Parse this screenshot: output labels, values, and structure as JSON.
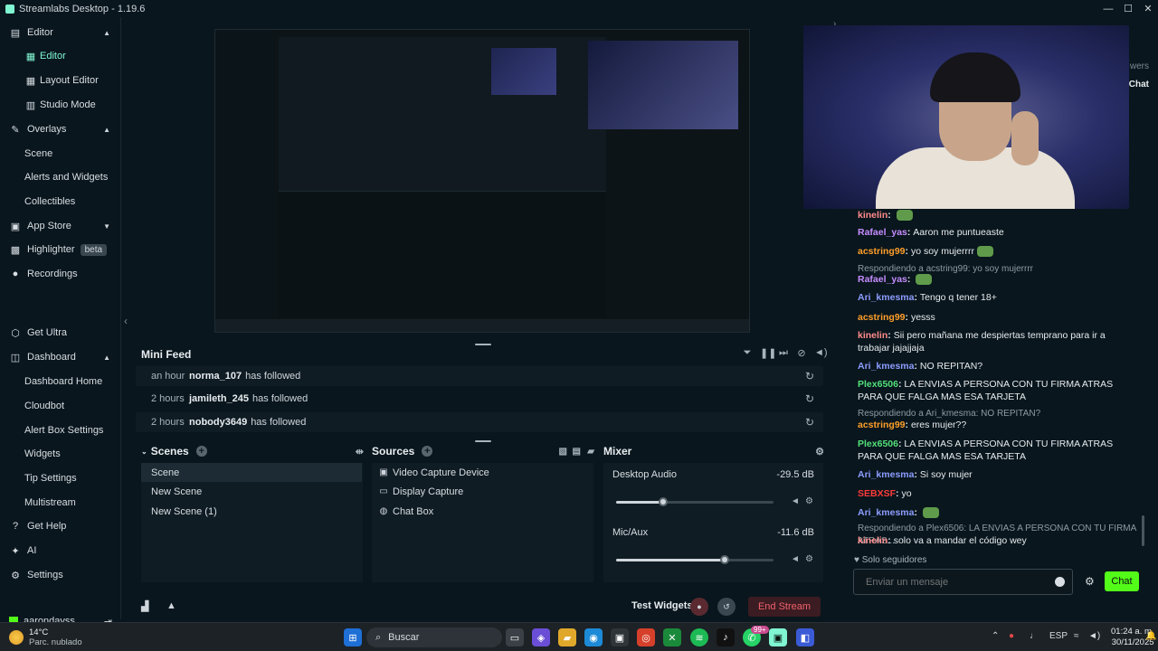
{
  "app": {
    "title": "Streamlabs Desktop - 1.19.6"
  },
  "sidebar": {
    "editor": "Editor",
    "editor_items": [
      "Editor",
      "Layout Editor",
      "Studio Mode"
    ],
    "overlays": "Overlays",
    "overlay_items": [
      "Scene",
      "Alerts and Widgets",
      "Collectibles"
    ],
    "app_store": "App Store",
    "highlighter": "Highlighter",
    "highlighter_badge": "beta",
    "recordings": "Recordings",
    "get_ultra": "Get Ultra",
    "dashboard": "Dashboard",
    "dashboard_items": [
      "Dashboard Home",
      "Cloudbot",
      "Alert Box Settings",
      "Widgets",
      "Tip Settings",
      "Multistream"
    ],
    "get_help": "Get Help",
    "ai": "AI",
    "settings": "Settings",
    "username": "aarondayss"
  },
  "minifeed": {
    "title": "Mini Feed",
    "rows": [
      {
        "time": "an hour",
        "user": "norma_107",
        "text": "has followed"
      },
      {
        "time": "2 hours",
        "user": "jamileth_245",
        "text": "has followed"
      },
      {
        "time": "2 hours",
        "user": "nobody3649",
        "text": "has followed"
      }
    ]
  },
  "scenes": {
    "title": "Scenes",
    "items": [
      "Scene",
      "New Scene",
      "New Scene (1)"
    ]
  },
  "sources": {
    "title": "Sources",
    "items": [
      "Video Capture Device",
      "Display Capture",
      "Chat Box"
    ]
  },
  "mixer": {
    "title": "Mixer",
    "channels": [
      {
        "name": "Desktop Audio",
        "db": "-29.5 dB",
        "level": 0.3
      },
      {
        "name": "Mic/Aux",
        "db": "-11.6 dB",
        "level": 0.69
      }
    ]
  },
  "bottom": {
    "test_widgets": "Test Widgets",
    "end_stream": "End Stream"
  },
  "chat": {
    "top_right_1": "wers",
    "top_right_2": "Chat",
    "messages": [
      {
        "name": "kinelin",
        "color": "#ff8c8c",
        "text": "",
        "emote": true
      },
      {
        "name": "Rafael_yas",
        "color": "#c68cff",
        "text": "Aaron me puntueaste"
      },
      {
        "name": "acstring99",
        "color": "#ff9f2a",
        "text": "yo soy mujerrrr",
        "emote": true
      },
      {
        "reply": "Respondiendo a acstring99: yo soy mujerrrr"
      },
      {
        "name": "Rafael_yas",
        "color": "#c68cff",
        "text": "",
        "emote": true
      },
      {
        "name": "Ari_kmesma",
        "color": "#8c9dff",
        "text": "Tengo q tener 18+"
      },
      {
        "name": "acstring99",
        "color": "#ff9f2a",
        "text": "yesss"
      },
      {
        "name": "kinelin",
        "color": "#ff8c8c",
        "text": "Sii pero mañana me despiertas temprano para ir a trabajar jajajjaja"
      },
      {
        "name": "Ari_kmesma",
        "color": "#8c9dff",
        "text": "NO REPITAN?"
      },
      {
        "name": "Plex6506",
        "color": "#53e07a",
        "text": "LA ENVIAS A PERSONA CON TU FIRMA ATRAS PARA QUE FALGA MAS ESA TARJETA"
      },
      {
        "reply": "Respondiendo a Ari_kmesma: NO REPITAN?"
      },
      {
        "name": "acstring99",
        "color": "#ff9f2a",
        "text": "eres mujer??"
      },
      {
        "name": "Plex6506",
        "color": "#53e07a",
        "text": "LA ENVIAS A PERSONA CON TU FIRMA ATRAS PARA QUE FALGA MAS ESA TARJETA"
      },
      {
        "name": "Ari_kmesma",
        "color": "#8c9dff",
        "text": "Si soy mujer"
      },
      {
        "name": "SEBXSF",
        "color": "#ff3b3b",
        "text": "yo"
      },
      {
        "name": "Ari_kmesma",
        "color": "#8c9dff",
        "text": "",
        "emote": true
      },
      {
        "reply": "Respondiendo a Plex6506: LA ENVIAS A PERSONA CON TU FIRMA ATRAS..."
      },
      {
        "name": "kinelin",
        "color": "#ff8c8c",
        "text": "solo va a mandar el código wey"
      }
    ],
    "solo": "Solo seguidores",
    "input_placeholder": "Enviar un mensaje",
    "send_label": "Chat"
  },
  "taskbar": {
    "temp": "14°C",
    "weather": "Parc. nublado",
    "search": "Buscar",
    "lang": "ESP",
    "time": "01:24 a. m.",
    "date": "30/11/2025",
    "badge": "99+"
  },
  "colors": {
    "accent": "#80f5d2",
    "kick_green": "#53fc18",
    "end_stream": "#f0606b"
  }
}
